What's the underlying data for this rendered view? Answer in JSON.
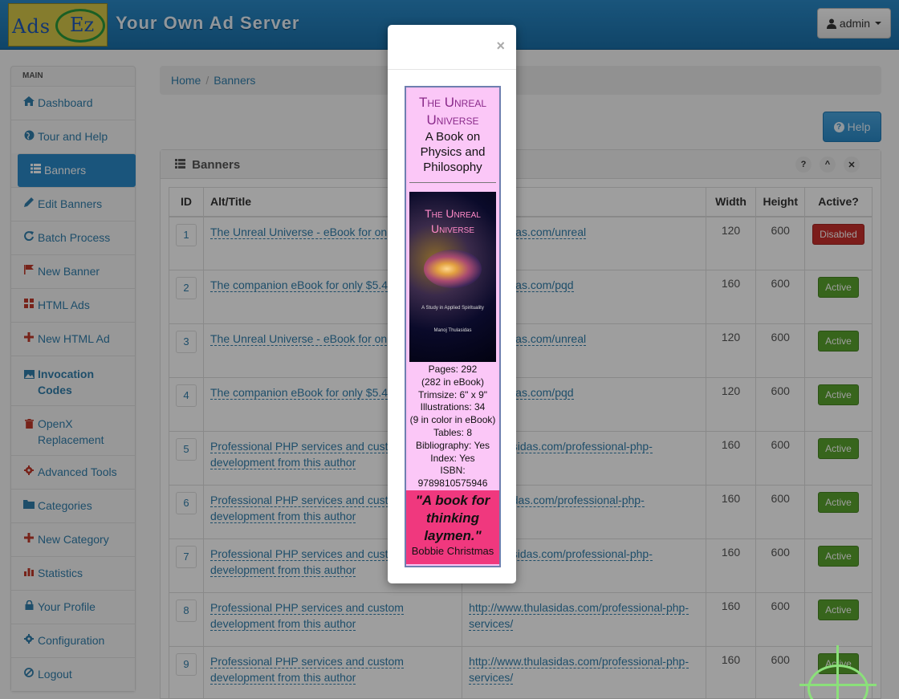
{
  "header": {
    "logo_left": "Ads",
    "logo_right": "Ez",
    "title": "Your Own Ad Server",
    "user_label": "admin"
  },
  "sidebar": {
    "section": "MAIN",
    "items": [
      {
        "label": "Dashboard",
        "icon": "home-icon"
      },
      {
        "label": "Tour and Help",
        "icon": "globe-icon"
      },
      {
        "label": "Banners",
        "icon": "list-icon"
      },
      {
        "label": "Edit Banners",
        "icon": "pencil-icon"
      },
      {
        "label": "Batch Process",
        "icon": "refresh-icon"
      },
      {
        "label": "New Banner",
        "icon": "flag-icon"
      },
      {
        "label": "HTML Ads",
        "icon": "grid-icon"
      },
      {
        "label": "New HTML Ad",
        "icon": "plus-icon"
      },
      {
        "label": "Invocation Codes",
        "icon": "picture-icon"
      },
      {
        "label": "OpenX Replacement",
        "icon": "trash-icon"
      },
      {
        "label": "Advanced Tools",
        "icon": "cog-icon"
      },
      {
        "label": "Categories",
        "icon": "folder-icon"
      },
      {
        "label": "New Category",
        "icon": "plus-icon"
      },
      {
        "label": "Statistics",
        "icon": "bar-chart-icon"
      },
      {
        "label": "Your Profile",
        "icon": "lock-icon"
      },
      {
        "label": "Configuration",
        "icon": "cog-icon"
      },
      {
        "label": "Logout",
        "icon": "ban-icon"
      }
    ]
  },
  "breadcrumb": {
    "home": "Home",
    "current": "Banners"
  },
  "help_label": "Help",
  "panel": {
    "title": "Banners",
    "columns": [
      "ID",
      "Alt/Title",
      "",
      "Width",
      "Height",
      "Active?"
    ],
    "rows": [
      {
        "id": "1",
        "title": "The Unreal Universe - eBook for on",
        "url": "y.thulasidas.com/unreal",
        "width": "120",
        "height": "600",
        "status": "Disabled",
        "status_color": "#c9302c"
      },
      {
        "id": "2",
        "title": "The companion eBook for only $5.4",
        "url": "y.thulasidas.com/pqd",
        "width": "160",
        "height": "600",
        "status": "Active",
        "status_color": "#5aa32e"
      },
      {
        "id": "3",
        "title": "The Unreal Universe - eBook for on",
        "url": "y.thulasidas.com/unreal",
        "width": "120",
        "height": "600",
        "status": "Active",
        "status_color": "#5aa32e"
      },
      {
        "id": "4",
        "title": "The companion eBook for only $5.4",
        "url": "y.thulasidas.com/pqd",
        "width": "120",
        "height": "600",
        "status": "Active",
        "status_color": "#5aa32e"
      },
      {
        "id": "5",
        "title": "Professional PHP services and cust",
        "title2": "development from this author",
        "url": "ww.thulasidas.com/professional-php-",
        "width": "160",
        "height": "600",
        "status": "Active",
        "status_color": "#5aa32e"
      },
      {
        "id": "6",
        "title": "Professional PHP services and cust",
        "title2": "development from this author",
        "url": "w.thulasidas.com/professional-php-",
        "width": "160",
        "height": "600",
        "status": "Active",
        "status_color": "#5aa32e"
      },
      {
        "id": "7",
        "title": "Professional PHP services and cust",
        "title2": "development from this author",
        "url": "ww.thulasidas.com/professional-php-",
        "width": "160",
        "height": "600",
        "status": "Active",
        "status_color": "#5aa32e"
      },
      {
        "id": "8",
        "title": "Professional PHP services and custom",
        "title2": "development from this author",
        "url": "http://www.thulasidas.com/professional-php-",
        "url2": "services/",
        "width": "160",
        "height": "600",
        "status": "Active",
        "status_color": "#5aa32e"
      },
      {
        "id": "9",
        "title": "Professional PHP services and custom",
        "title2": "development from this author",
        "url": "http://www.thulasidas.com/professional-php-",
        "url2": "services/",
        "width": "160",
        "height": "600",
        "status": "Active",
        "status_color": "#5aa32e"
      }
    ]
  },
  "modal": {
    "close": "×",
    "ad": {
      "title_line1": "The Unreal",
      "title_line2": "Universe",
      "subtitle_l1": "A Book on",
      "subtitle_l2": "Physics and",
      "subtitle_l3": "Philosophy",
      "cover_t1": "The Unreal",
      "cover_t2": "Universe",
      "cover_sub": "A Study in Applied Spirituality",
      "cover_author": "Manoj Thulasidas",
      "specs": [
        "Pages: 292",
        "(282 in eBook)",
        "Trimsize: 6\" x 9\"",
        "Illustrations: 34",
        "(9 in color in eBook)",
        "Tables: 8",
        "Bibliography: Yes",
        "Index: Yes",
        "ISBN:",
        "9789810575946"
      ],
      "quote_l1": "\"A book for",
      "quote_l2": "thinking",
      "quote_l3": "laymen.\"",
      "quote_author": "Bobbie Christmas"
    }
  }
}
